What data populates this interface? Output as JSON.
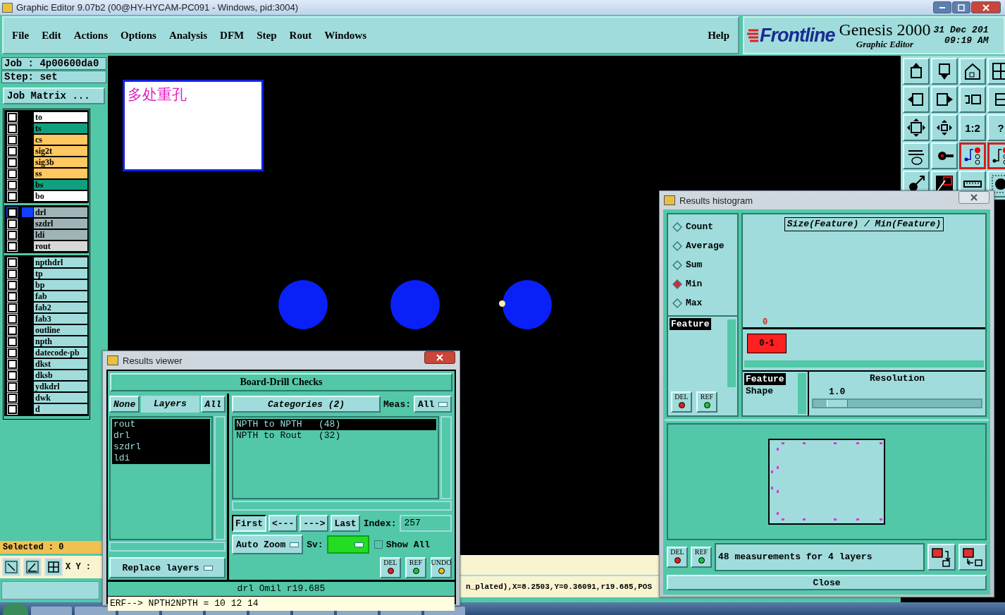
{
  "window": {
    "title": "Graphic Editor 9.07b2 (00@HY-HYCAM-PC091 - Windows, pid:3004)"
  },
  "menu": [
    "File",
    "Edit",
    "Actions",
    "Options",
    "Analysis",
    "DFM",
    "Step",
    "Rout",
    "Windows"
  ],
  "help": "Help",
  "brand": {
    "logo": "Frontline",
    "product": "Genesis 2000",
    "subtitle": "Graphic Editor",
    "date": "31 Dec 201",
    "time": "09:19 AM"
  },
  "job": "Job : 4p00600da0",
  "step": "Step: set",
  "job_matrix_button": "Job Matrix ...",
  "layer_groups": [
    {
      "layers": [
        {
          "name": "to",
          "color": "#ffffff",
          "checked": false,
          "selected": false
        },
        {
          "name": "ts",
          "color": "#10a080",
          "checked": false,
          "selected": false
        },
        {
          "name": "cs",
          "color": "#ffc860",
          "checked": false,
          "selected": false
        },
        {
          "name": "sig2t",
          "color": "#ffc860",
          "checked": false,
          "selected": false
        },
        {
          "name": "sig3b",
          "color": "#ffc860",
          "checked": false,
          "selected": false
        },
        {
          "name": "ss",
          "color": "#ffc860",
          "checked": false,
          "selected": false
        },
        {
          "name": "bs",
          "color": "#10a080",
          "checked": false,
          "selected": false
        },
        {
          "name": "bo",
          "color": "#ffffff",
          "checked": false,
          "selected": false
        }
      ]
    },
    {
      "layers": [
        {
          "name": "drl",
          "color": "#a0b4b8",
          "checked": false,
          "selected": true
        },
        {
          "name": "szdrl",
          "color": "#a0b4b8",
          "checked": false,
          "selected": false
        },
        {
          "name": "ldi",
          "color": "#a0b4b8",
          "checked": false,
          "selected": false
        },
        {
          "name": "rout",
          "color": "#d8d8d8",
          "checked": false,
          "selected": false
        }
      ]
    },
    {
      "layers": [
        {
          "name": "npthdrl",
          "color": "#a0dcdc",
          "checked": false,
          "selected": false
        },
        {
          "name": "tp",
          "color": "#a0dcdc",
          "checked": false,
          "selected": false
        },
        {
          "name": "bp",
          "color": "#a0dcdc",
          "checked": false,
          "selected": false
        },
        {
          "name": "fab",
          "color": "#a0dcdc",
          "checked": false,
          "selected": false
        },
        {
          "name": "fab2",
          "color": "#a0dcdc",
          "checked": false,
          "selected": false
        },
        {
          "name": "fab3",
          "color": "#a0dcdc",
          "checked": false,
          "selected": false
        },
        {
          "name": "outline",
          "color": "#a0dcdc",
          "checked": false,
          "selected": false
        },
        {
          "name": "npth",
          "color": "#a0dcdc",
          "checked": false,
          "selected": false
        },
        {
          "name": "datecode-pb",
          "color": "#a0dcdc",
          "checked": false,
          "selected": false
        },
        {
          "name": "dkst",
          "color": "#a0dcdc",
          "checked": false,
          "selected": false
        },
        {
          "name": "dksb",
          "color": "#a0dcdc",
          "checked": false,
          "selected": false
        },
        {
          "name": "ydkdrl",
          "color": "#a0dcdc",
          "checked": false,
          "selected": false
        },
        {
          "name": "dwk",
          "color": "#a0dcdc",
          "checked": false,
          "selected": false
        },
        {
          "name": "d",
          "color": "#a0dcdc",
          "checked": false,
          "selected": false
        }
      ]
    }
  ],
  "selected_count": "Selected : 0",
  "xy_label": "X Y :",
  "canvas": {
    "note": "多处重孔"
  },
  "toolbar": [
    {
      "kind": "icon"
    },
    {
      "kind": "icon"
    },
    {
      "kind": "icon"
    },
    {
      "kind": "icon"
    },
    {
      "kind": "icon"
    },
    {
      "kind": "icon"
    },
    {
      "kind": "icon"
    },
    {
      "kind": "icon"
    },
    {
      "kind": "icon"
    },
    {
      "kind": "icon"
    },
    {
      "kind": "text",
      "label": "1:2"
    },
    {
      "kind": "text",
      "label": "?"
    },
    {
      "kind": "icon"
    },
    {
      "kind": "icon"
    },
    {
      "kind": "icon"
    },
    {
      "kind": "icon"
    },
    {
      "kind": "icon"
    },
    {
      "kind": "icon"
    },
    {
      "kind": "icon"
    },
    {
      "kind": "icon"
    }
  ],
  "status_line": "n_plated),X=8.2503,Y=0.36091,r19.685,POS",
  "results_viewer": {
    "title": "Results viewer",
    "header": "Board-Drill Checks",
    "none_button": "None",
    "layers_label": "Layers",
    "all_button": "All",
    "layers": [
      {
        "name": "rout",
        "selected": true
      },
      {
        "name": "drl",
        "selected": true
      },
      {
        "name": "szdrl",
        "selected": true
      },
      {
        "name": "ldi",
        "selected": true
      }
    ],
    "categories_label": "Categories (2)",
    "meas_label": "Meas:",
    "meas_value": "All",
    "categories": [
      {
        "label": "NPTH to NPTH   (48)",
        "selected": true
      },
      {
        "label": "NPTH to Rout   (32)",
        "selected": false
      }
    ],
    "nav": [
      "First",
      "<---",
      "--->",
      "Last"
    ],
    "index_label": "Index:",
    "index_value": "257",
    "auto_zoom": "Auto Zoom",
    "sv_label": "Sv:",
    "show_all": {
      "label": "Show All",
      "checked": false
    },
    "replace_layers": "Replace layers",
    "tool_buttons": [
      "DEL",
      "REF",
      "UNDO"
    ],
    "info": "drl  Omil   r19.685",
    "erf": "ERF--> NPTH2NPTH = 10 12 14"
  },
  "results_histogram": {
    "title": "Results histogram",
    "modes": [
      {
        "label": "Count",
        "selected": false
      },
      {
        "label": "Average",
        "selected": false
      },
      {
        "label": "Sum",
        "selected": false
      },
      {
        "label": "Min",
        "selected": true
      },
      {
        "label": "Max",
        "selected": false
      }
    ],
    "feature_list": [
      {
        "label": "Feature",
        "selected": true
      }
    ],
    "chart_title": "Size(Feature) / Min(Feature)",
    "bar_count": "0",
    "bin_label": "0-1",
    "attributes": [
      {
        "label": "Feature",
        "selected": true
      },
      {
        "label": "Shape",
        "selected": false
      }
    ],
    "resolution_label": "Resolution",
    "resolution_value": "1.0",
    "resolution": {
      "level": 0.08
    },
    "buttons": [
      "DEL",
      "REF"
    ],
    "bottom_buttons": [
      "DEL",
      "REF"
    ],
    "summary": "48 measurements for 4 layers",
    "close": "Close"
  }
}
